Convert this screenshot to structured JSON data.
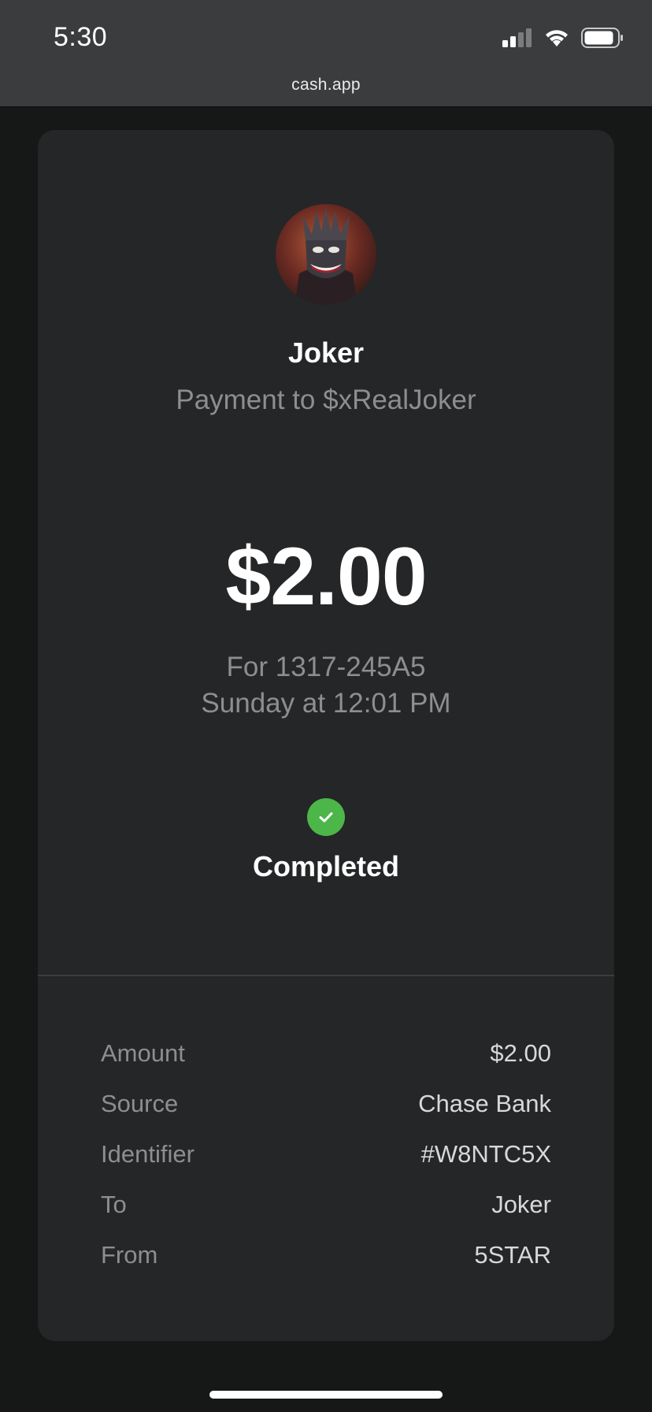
{
  "status_bar": {
    "time": "5:30",
    "url": "cash.app",
    "icons": [
      "cellular-signal-icon",
      "wifi-icon",
      "battery-icon"
    ]
  },
  "payment": {
    "avatar": "avatar-image",
    "name": "Joker",
    "subtitle": "Payment to $xRealJoker",
    "amount": "$2.00",
    "memo": "For 1317-245A5",
    "date": "Sunday at 12:01 PM",
    "status": "Completed",
    "status_icon": "check-circle-icon",
    "status_color": "#4cb648"
  },
  "details": [
    {
      "label": "Amount",
      "value": "$2.00"
    },
    {
      "label": "Source",
      "value": "Chase Bank"
    },
    {
      "label": "Identifier",
      "value": "#W8NTC5X"
    },
    {
      "label": "To",
      "value": "Joker"
    },
    {
      "label": "From",
      "value": "5STAR"
    }
  ]
}
